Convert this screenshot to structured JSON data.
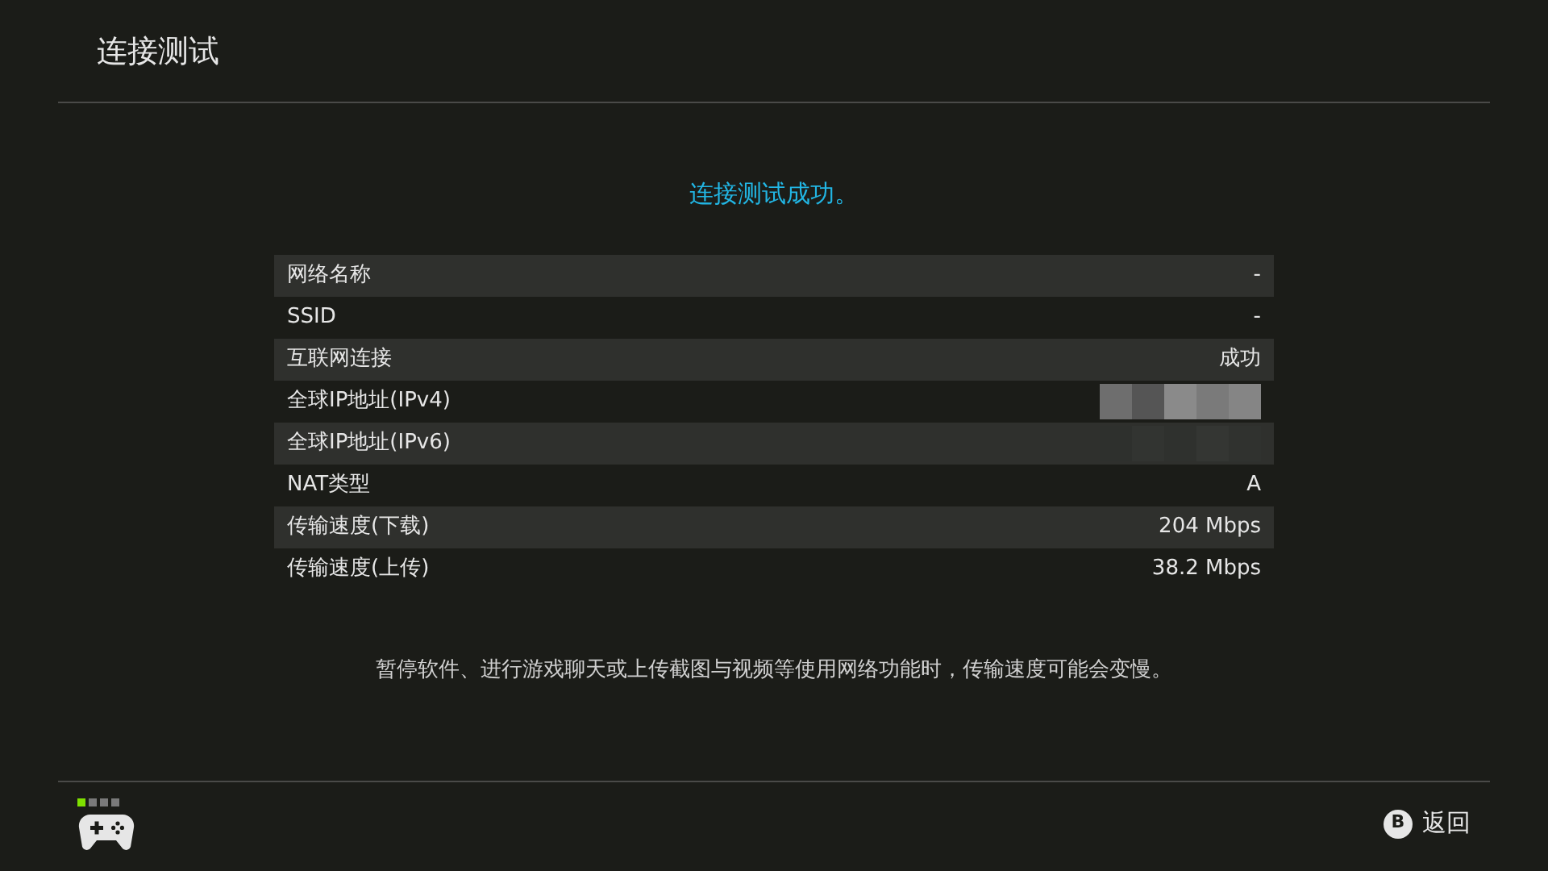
{
  "header": {
    "title": "连接测试"
  },
  "status": "连接测试成功。",
  "rows": [
    {
      "label": "网络名称",
      "kind": "text",
      "value": "-"
    },
    {
      "label": "SSID",
      "kind": "text",
      "value": "-"
    },
    {
      "label": "互联网连接",
      "kind": "text",
      "value": "成功"
    },
    {
      "label": "全球IP地址(IPv4)",
      "kind": "redacted"
    },
    {
      "label": "全球IP地址(IPv6)",
      "kind": "redacted"
    },
    {
      "label": "NAT类型",
      "kind": "text",
      "value": "A"
    },
    {
      "label": "传输速度(下载)",
      "kind": "text",
      "value": "204 Mbps"
    },
    {
      "label": "传输速度(上传)",
      "kind": "text",
      "value": "38.2 Mbps"
    }
  ],
  "note": "暂停软件、进行游戏聊天或上传截图与视频等使用网络功能时，传输速度可能会变慢。",
  "footer": {
    "player_lights": [
      {
        "on": true
      },
      {
        "on": false
      },
      {
        "on": false
      },
      {
        "on": false
      }
    ],
    "back_key": "B",
    "back_label": "返回"
  }
}
